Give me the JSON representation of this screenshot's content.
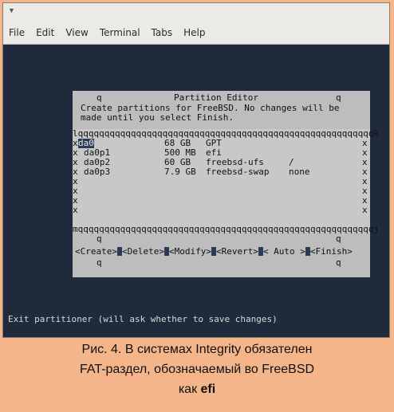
{
  "window": {
    "menu": [
      "File",
      "Edit",
      "View",
      "Terminal",
      "Tabs",
      "Help"
    ]
  },
  "dialog": {
    "title": "Partition Editor",
    "intro_line1": "Create partitions for FreeBSD. No changes will be",
    "intro_line2": "made until you select Finish.",
    "corner_char": "q",
    "border_top": "lqqqqqqqqqqqqqqqqqqqqqqqqqqqqqqqqqqqqqqqqqqqqqqqqqqqqqqqqk",
    "border_bottom": "mqqqqqqqqqqqqqqqqqqqqqqqqqqqqqqqqqqqqqqqqqqqqqqqqqqqqqqqqj",
    "side_char": "x",
    "partitions": [
      {
        "name": "da0",
        "size": "68 GB",
        "type": "GPT",
        "mount": ""
      },
      {
        "name": "da0p1",
        "size": "500 MB",
        "type": "efi",
        "mount": ""
      },
      {
        "name": "da0p2",
        "size": "60 GB",
        "type": "freebsd-ufs",
        "mount": "/"
      },
      {
        "name": "da0p3",
        "size": "7.9 GB",
        "type": "freebsd-swap",
        "mount": "none"
      }
    ],
    "buttons": [
      "<Create>",
      "<Delete>",
      "<Modify>",
      "<Revert>",
      "< Auto >",
      "<Finish>"
    ]
  },
  "status_line": "Exit partitioner (will ask whether to save changes)",
  "caption": {
    "line1": "Рис. 4. В системах Integrity обязателен",
    "line2": "FAT-раздел, обозначаемый во FreeBSD",
    "line3_prefix": "как ",
    "line3_bold": "efi"
  },
  "colors": {
    "terminal_bg": "#1f2a3c",
    "dialog_bg": "#bdbdbd",
    "selection_bg": "#2b3a55",
    "caption_bg": "#f4b58a"
  }
}
